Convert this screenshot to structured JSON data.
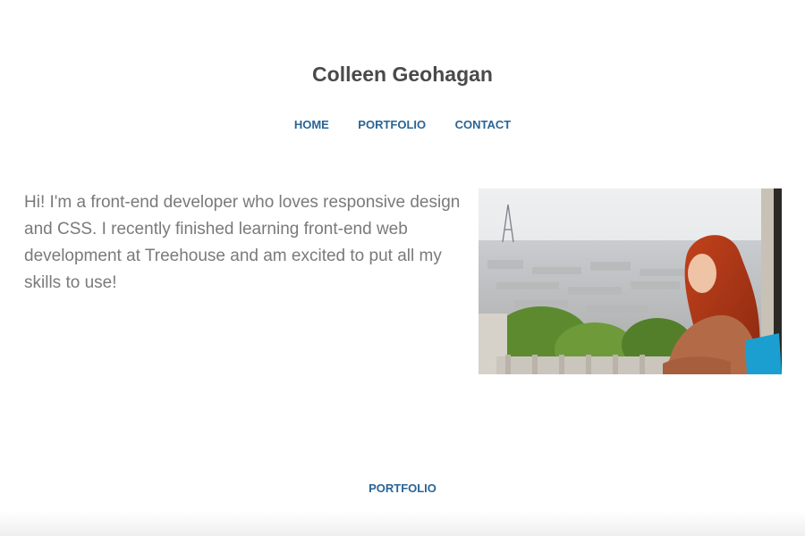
{
  "header": {
    "title": "Colleen Geohagan"
  },
  "nav": {
    "items": [
      {
        "label": "HOME"
      },
      {
        "label": "PORTFOLIO"
      },
      {
        "label": "CONTACT"
      }
    ]
  },
  "main": {
    "intro_text": "Hi! I'm a front-end developer who loves responsive design and CSS. I recently finished learning front-end web development at Treehouse and am excited to put all my skills to use!",
    "photo_icon": "profile-photo"
  },
  "footer": {
    "link_label": "PORTFOLIO"
  },
  "colors": {
    "link": "#2a6496",
    "title": "#4a4a4a",
    "body_text": "#7a7a7a",
    "background": "#ffffff"
  }
}
